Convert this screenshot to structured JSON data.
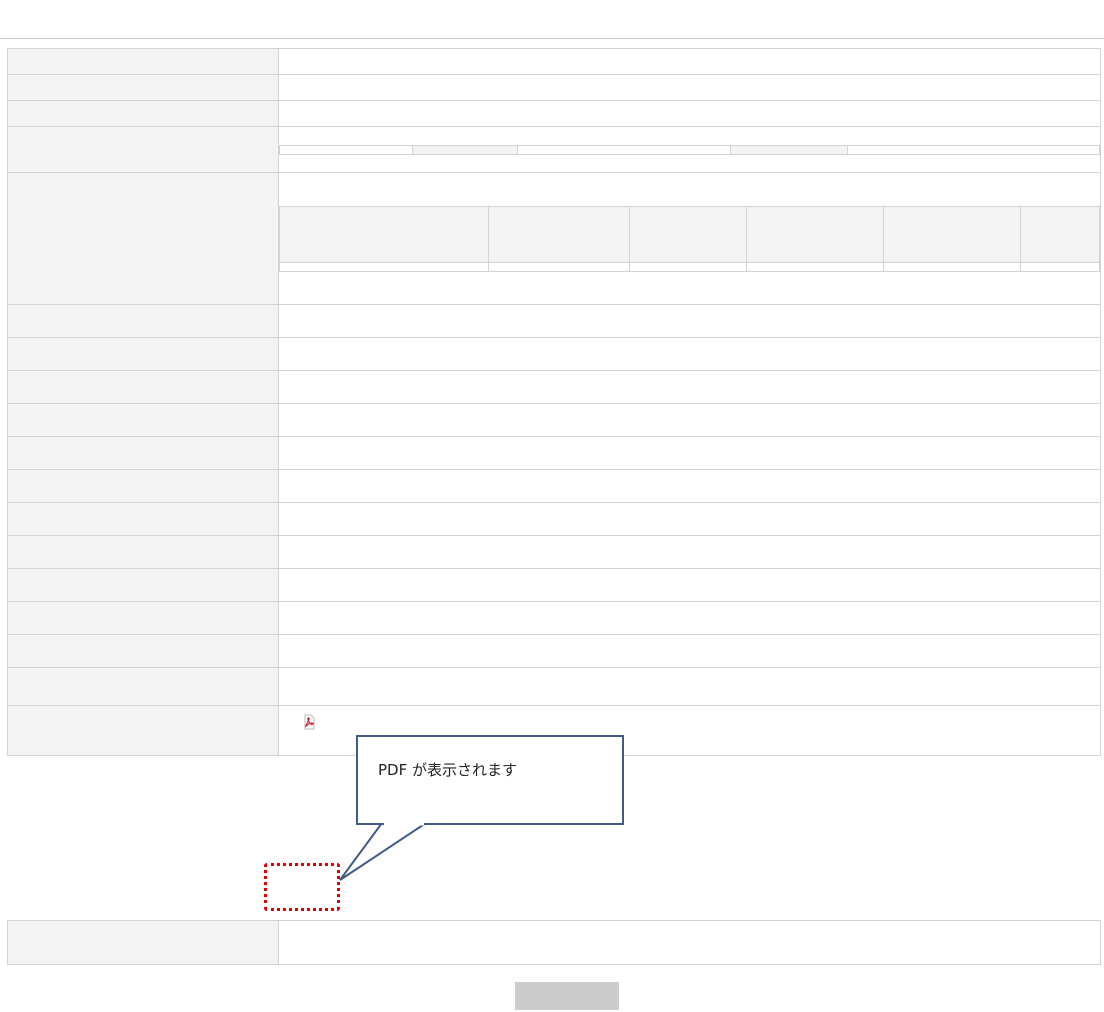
{
  "page": {
    "title": ""
  },
  "rows": {
    "r1": {
      "label": "",
      "value": ""
    },
    "r2": {
      "label": "",
      "value": ""
    },
    "r3": {
      "label": "",
      "value": ""
    },
    "account": {
      "label": "",
      "number": "",
      "limit_label": "",
      "limit_value": "",
      "limit_basis": "",
      "limit_remain_label": "",
      "limit_remain_value": "",
      "limit_remain_basis": ""
    },
    "confirm": {
      "label": "",
      "headers": [
        "",
        "",
        "",
        "",
        "",
        ""
      ],
      "cells": {
        "customer_line1": "",
        "customer_line2": "",
        "customer_id": "",
        "applicant": "",
        "applied_at": "",
        "approver_name": "",
        "approver_id": "",
        "approved_date": "",
        "approved_time": "",
        "state": ""
      }
    },
    "r6": {
      "label": "",
      "value": ""
    },
    "r7": {
      "label": "",
      "value": ""
    },
    "r8": {
      "label": "",
      "value": ""
    },
    "r9": {
      "label": "",
      "value": ""
    },
    "r10": {
      "label": "",
      "value": ""
    },
    "r11": {
      "label": "",
      "value": ""
    },
    "r12": {
      "label": "",
      "value": ""
    },
    "r13": {
      "label": "",
      "value": ""
    },
    "r14": {
      "label": "",
      "value": ""
    },
    "r15": {
      "label": "",
      "value": ""
    },
    "r16": {
      "label": "",
      "value": ""
    },
    "r17": {
      "label": "",
      "value": ""
    },
    "pdf": {
      "label": "",
      "icon": "pdf-file-icon"
    },
    "return_reason": {
      "label": "",
      "value": ""
    }
  },
  "callout": {
    "text": "PDF が表示されます"
  },
  "actions": {
    "back_label": ""
  },
  "colors": {
    "highlight": "#e00000",
    "callout_border": "#3f5b86",
    "header_bg": "#f3f3f3"
  }
}
